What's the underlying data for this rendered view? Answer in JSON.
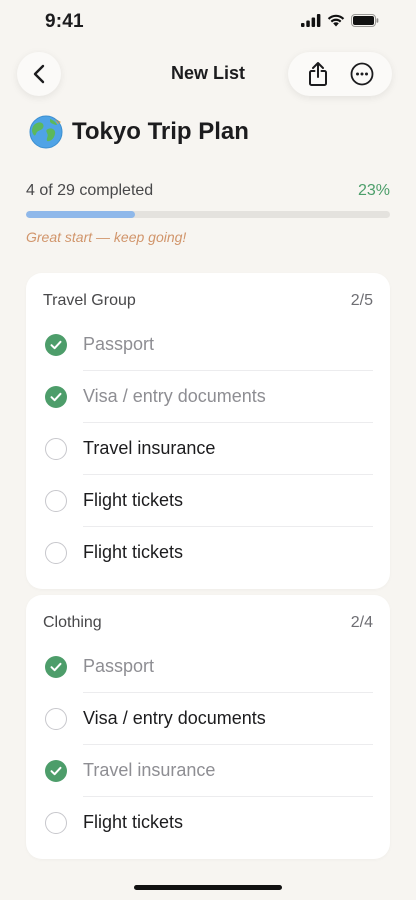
{
  "status_bar": {
    "time": "9:41"
  },
  "nav": {
    "title": "New List"
  },
  "list": {
    "emoji_icon": "globe-icon",
    "title": "Tokyo Trip Plan"
  },
  "progress": {
    "label": "4 of 29 completed",
    "percent_text": "23%",
    "fraction": 0.3,
    "note": "Great start — keep going!"
  },
  "colors": {
    "accent_green": "#4d9d6a",
    "progress_blue": "#8fb8ea",
    "note_orange": "#d1956b"
  },
  "groups": [
    {
      "title": "Travel Group",
      "count": "2/5",
      "items": [
        {
          "label": "Passport",
          "done": true
        },
        {
          "label": "Visa / entry documents",
          "done": true
        },
        {
          "label": "Travel insurance",
          "done": false
        },
        {
          "label": "Flight tickets",
          "done": false
        },
        {
          "label": "Flight tickets",
          "done": false
        }
      ]
    },
    {
      "title": "Clothing",
      "count": "2/4",
      "items": [
        {
          "label": "Passport",
          "done": true
        },
        {
          "label": "Visa / entry documents",
          "done": false
        },
        {
          "label": "Travel insurance",
          "done": true
        },
        {
          "label": "Flight tickets",
          "done": false
        }
      ]
    }
  ]
}
